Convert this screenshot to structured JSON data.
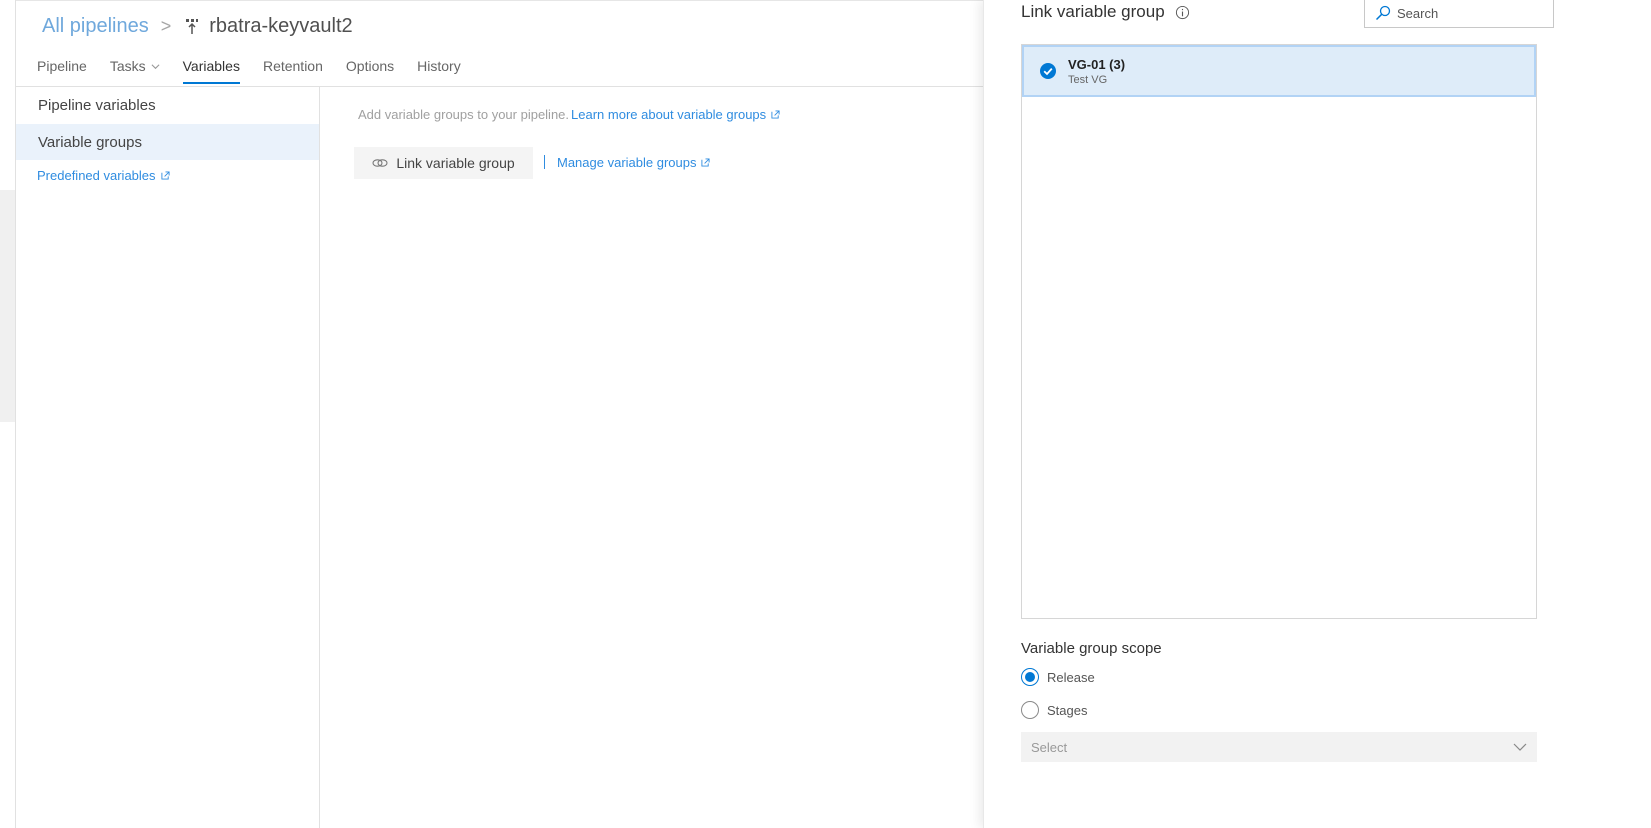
{
  "breadcrumb": {
    "root": "All pipelines",
    "separator": ">",
    "current": "rbatra-keyvault2"
  },
  "tabs": [
    {
      "label": "Pipeline"
    },
    {
      "label": "Tasks"
    },
    {
      "label": "Variables"
    },
    {
      "label": "Retention"
    },
    {
      "label": "Options"
    },
    {
      "label": "History"
    }
  ],
  "active_tab": "Variables",
  "sidebar": {
    "items": [
      {
        "label": "Pipeline variables"
      },
      {
        "label": "Variable groups"
      }
    ],
    "selected": "Variable groups",
    "link": "Predefined variables"
  },
  "main": {
    "hint": "Add variable groups to your pipeline.",
    "learn_more": "Learn more about variable groups",
    "link_button": "Link variable group",
    "separator": "|",
    "manage_link": "Manage variable groups"
  },
  "panel": {
    "title": "Link variable group",
    "search_placeholder": "Search",
    "groups": [
      {
        "name": "VG-01 (3)",
        "description": "Test VG",
        "selected": true
      }
    ],
    "scope_label": "Variable group scope",
    "scope_options": [
      {
        "label": "Release",
        "selected": true
      },
      {
        "label": "Stages",
        "selected": false
      }
    ],
    "stage_select": "Select"
  },
  "colors": {
    "accent": "#0078d4",
    "link": "#2f8ce0",
    "selected_bg": "#deecf9"
  }
}
